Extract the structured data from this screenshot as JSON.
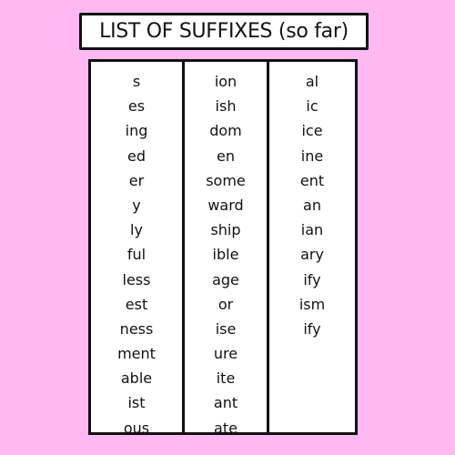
{
  "title": "LIST OF SUFFIXES (so far)",
  "colors": {
    "background": "#ffb8f2",
    "border": "#111111",
    "panel": "#ffffff"
  },
  "columns": [
    [
      "s",
      "es",
      "ing",
      "ed",
      "er",
      "y",
      "ly",
      "ful",
      "less",
      "est",
      "ness",
      "ment",
      "able",
      "ist",
      "ous"
    ],
    [
      "ion",
      "ish",
      "dom",
      "en",
      "some",
      "ward",
      "ship",
      "ible",
      "age",
      "or",
      "ise",
      "ure",
      "ite",
      "ant",
      "ate"
    ],
    [
      "al",
      "ic",
      "ice",
      "ine",
      "ent",
      "an",
      "ian",
      "ary",
      "ify",
      "ism",
      "ify"
    ]
  ]
}
